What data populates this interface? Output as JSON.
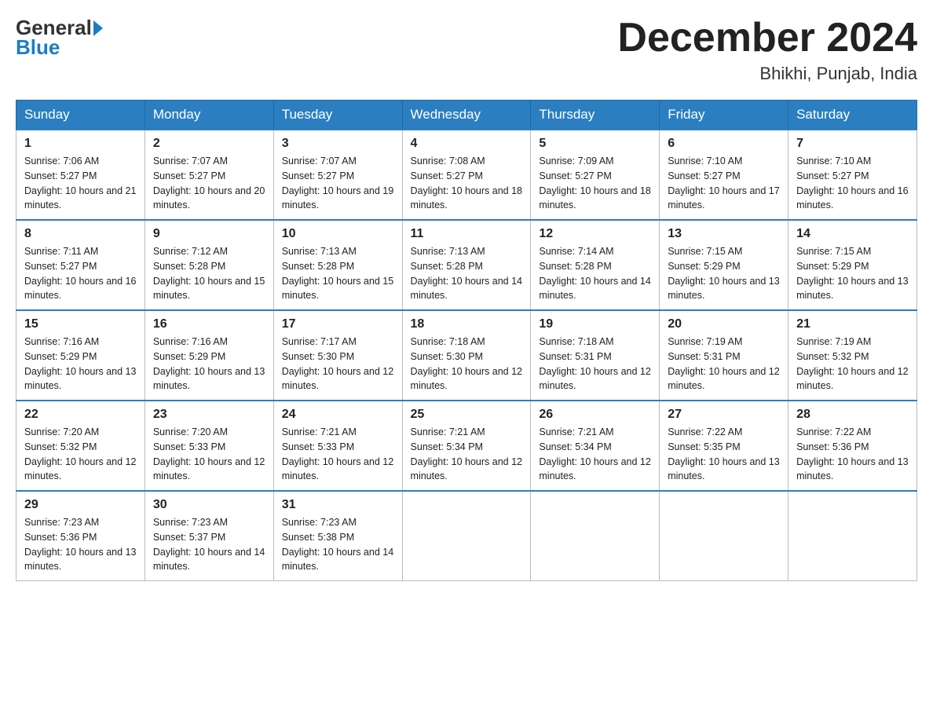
{
  "header": {
    "logo_general": "General",
    "logo_blue": "Blue",
    "title": "December 2024",
    "subtitle": "Bhikhi, Punjab, India"
  },
  "days_of_week": [
    "Sunday",
    "Monday",
    "Tuesday",
    "Wednesday",
    "Thursday",
    "Friday",
    "Saturday"
  ],
  "weeks": [
    [
      {
        "day": "1",
        "sunrise": "7:06 AM",
        "sunset": "5:27 PM",
        "daylight": "10 hours and 21 minutes."
      },
      {
        "day": "2",
        "sunrise": "7:07 AM",
        "sunset": "5:27 PM",
        "daylight": "10 hours and 20 minutes."
      },
      {
        "day": "3",
        "sunrise": "7:07 AM",
        "sunset": "5:27 PM",
        "daylight": "10 hours and 19 minutes."
      },
      {
        "day": "4",
        "sunrise": "7:08 AM",
        "sunset": "5:27 PM",
        "daylight": "10 hours and 18 minutes."
      },
      {
        "day": "5",
        "sunrise": "7:09 AM",
        "sunset": "5:27 PM",
        "daylight": "10 hours and 18 minutes."
      },
      {
        "day": "6",
        "sunrise": "7:10 AM",
        "sunset": "5:27 PM",
        "daylight": "10 hours and 17 minutes."
      },
      {
        "day": "7",
        "sunrise": "7:10 AM",
        "sunset": "5:27 PM",
        "daylight": "10 hours and 16 minutes."
      }
    ],
    [
      {
        "day": "8",
        "sunrise": "7:11 AM",
        "sunset": "5:27 PM",
        "daylight": "10 hours and 16 minutes."
      },
      {
        "day": "9",
        "sunrise": "7:12 AM",
        "sunset": "5:28 PM",
        "daylight": "10 hours and 15 minutes."
      },
      {
        "day": "10",
        "sunrise": "7:13 AM",
        "sunset": "5:28 PM",
        "daylight": "10 hours and 15 minutes."
      },
      {
        "day": "11",
        "sunrise": "7:13 AM",
        "sunset": "5:28 PM",
        "daylight": "10 hours and 14 minutes."
      },
      {
        "day": "12",
        "sunrise": "7:14 AM",
        "sunset": "5:28 PM",
        "daylight": "10 hours and 14 minutes."
      },
      {
        "day": "13",
        "sunrise": "7:15 AM",
        "sunset": "5:29 PM",
        "daylight": "10 hours and 13 minutes."
      },
      {
        "day": "14",
        "sunrise": "7:15 AM",
        "sunset": "5:29 PM",
        "daylight": "10 hours and 13 minutes."
      }
    ],
    [
      {
        "day": "15",
        "sunrise": "7:16 AM",
        "sunset": "5:29 PM",
        "daylight": "10 hours and 13 minutes."
      },
      {
        "day": "16",
        "sunrise": "7:16 AM",
        "sunset": "5:29 PM",
        "daylight": "10 hours and 13 minutes."
      },
      {
        "day": "17",
        "sunrise": "7:17 AM",
        "sunset": "5:30 PM",
        "daylight": "10 hours and 12 minutes."
      },
      {
        "day": "18",
        "sunrise": "7:18 AM",
        "sunset": "5:30 PM",
        "daylight": "10 hours and 12 minutes."
      },
      {
        "day": "19",
        "sunrise": "7:18 AM",
        "sunset": "5:31 PM",
        "daylight": "10 hours and 12 minutes."
      },
      {
        "day": "20",
        "sunrise": "7:19 AM",
        "sunset": "5:31 PM",
        "daylight": "10 hours and 12 minutes."
      },
      {
        "day": "21",
        "sunrise": "7:19 AM",
        "sunset": "5:32 PM",
        "daylight": "10 hours and 12 minutes."
      }
    ],
    [
      {
        "day": "22",
        "sunrise": "7:20 AM",
        "sunset": "5:32 PM",
        "daylight": "10 hours and 12 minutes."
      },
      {
        "day": "23",
        "sunrise": "7:20 AM",
        "sunset": "5:33 PM",
        "daylight": "10 hours and 12 minutes."
      },
      {
        "day": "24",
        "sunrise": "7:21 AM",
        "sunset": "5:33 PM",
        "daylight": "10 hours and 12 minutes."
      },
      {
        "day": "25",
        "sunrise": "7:21 AM",
        "sunset": "5:34 PM",
        "daylight": "10 hours and 12 minutes."
      },
      {
        "day": "26",
        "sunrise": "7:21 AM",
        "sunset": "5:34 PM",
        "daylight": "10 hours and 12 minutes."
      },
      {
        "day": "27",
        "sunrise": "7:22 AM",
        "sunset": "5:35 PM",
        "daylight": "10 hours and 13 minutes."
      },
      {
        "day": "28",
        "sunrise": "7:22 AM",
        "sunset": "5:36 PM",
        "daylight": "10 hours and 13 minutes."
      }
    ],
    [
      {
        "day": "29",
        "sunrise": "7:23 AM",
        "sunset": "5:36 PM",
        "daylight": "10 hours and 13 minutes."
      },
      {
        "day": "30",
        "sunrise": "7:23 AM",
        "sunset": "5:37 PM",
        "daylight": "10 hours and 14 minutes."
      },
      {
        "day": "31",
        "sunrise": "7:23 AM",
        "sunset": "5:38 PM",
        "daylight": "10 hours and 14 minutes."
      },
      null,
      null,
      null,
      null
    ]
  ]
}
